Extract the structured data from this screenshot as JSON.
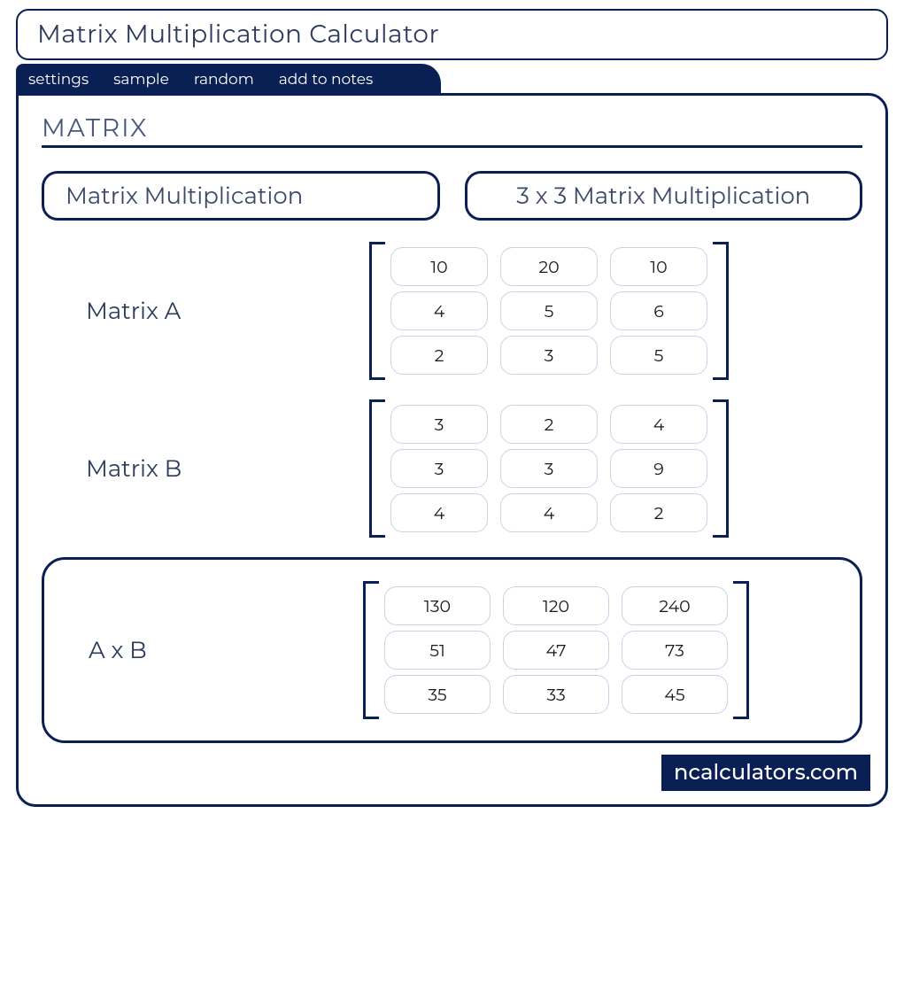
{
  "title": "Matrix Multiplication Calculator",
  "tabs": {
    "settings": "settings",
    "sample": "sample",
    "random": "random",
    "add_to_notes": "add to notes"
  },
  "section_header": "MATRIX",
  "pills": {
    "left": "Matrix Multiplication",
    "right": "3 x 3 Matrix Multiplication"
  },
  "matrices": {
    "a": {
      "label": "Matrix A",
      "rows": [
        [
          "10",
          "20",
          "10"
        ],
        [
          "4",
          "5",
          "6"
        ],
        [
          "2",
          "3",
          "5"
        ]
      ]
    },
    "b": {
      "label": "Matrix B",
      "rows": [
        [
          "3",
          "2",
          "4"
        ],
        [
          "3",
          "3",
          "9"
        ],
        [
          "4",
          "4",
          "2"
        ]
      ]
    },
    "result": {
      "label": "A x B",
      "rows": [
        [
          "130",
          "120",
          "240"
        ],
        [
          "51",
          "47",
          "73"
        ],
        [
          "35",
          "33",
          "45"
        ]
      ]
    }
  },
  "footer": "ncalculators.com"
}
